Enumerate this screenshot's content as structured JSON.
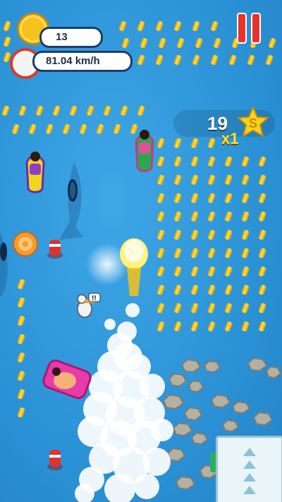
{
  "hud": {
    "coins": "13",
    "speed": "81.04 km/h",
    "score": "19",
    "multiplier": "x1",
    "star_letter": "S"
  },
  "icons": {
    "coin": "coin-icon",
    "speedometer": "speedometer-icon",
    "pause": "pause-icon",
    "star": "star-icon"
  },
  "colors": {
    "water": "#2d94d8",
    "coin": "#f6c21c",
    "pause": "#e8332c",
    "multiplier": "#ffe22a"
  }
}
